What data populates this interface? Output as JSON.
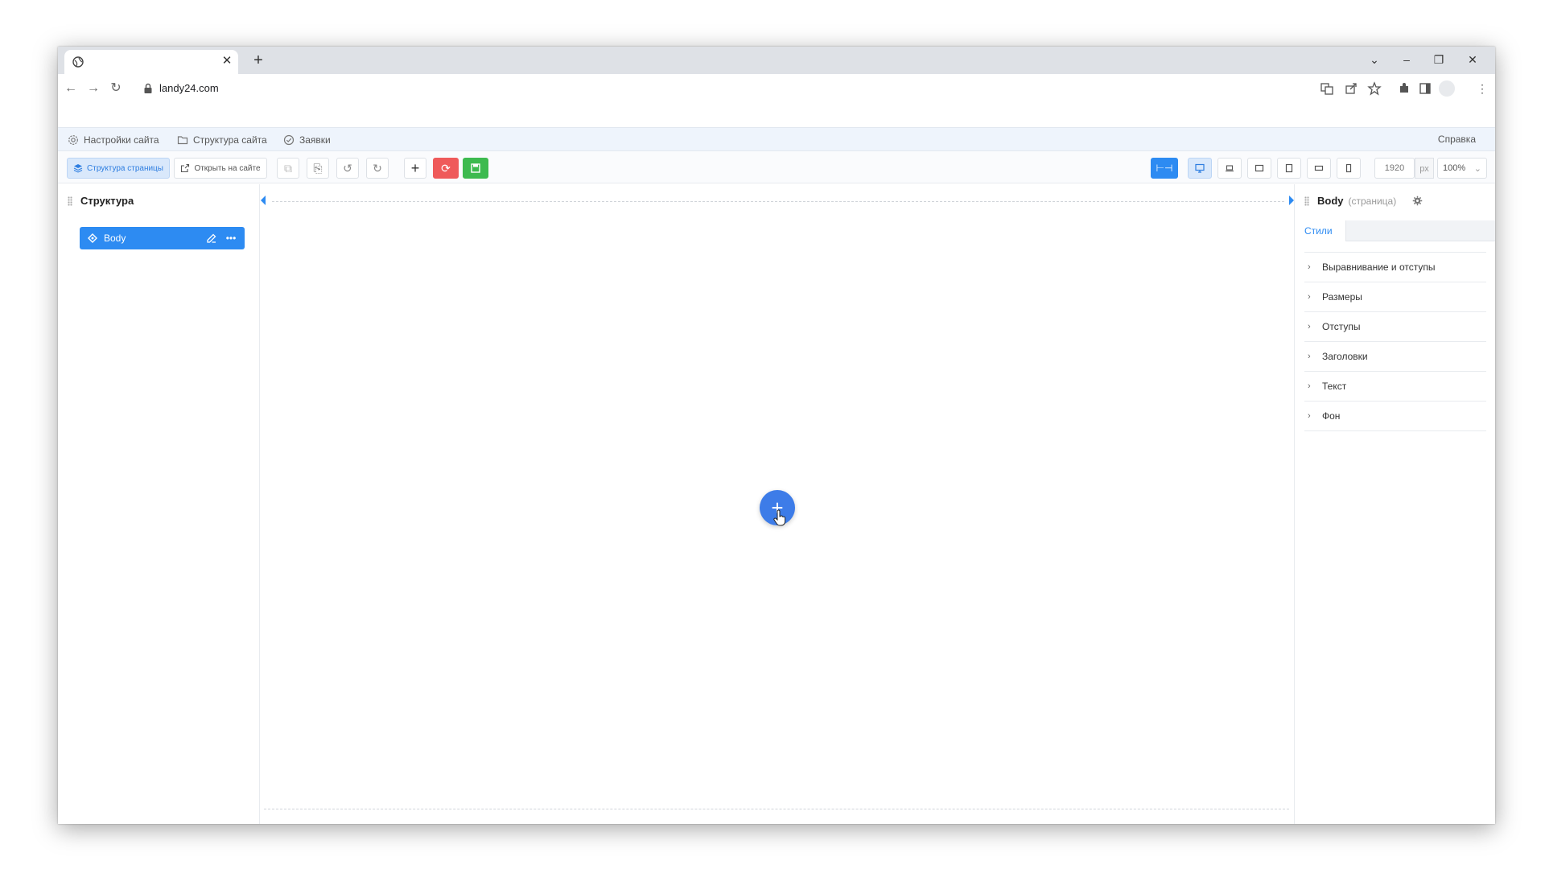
{
  "browser": {
    "tab_close": "✕",
    "new_tab": "+",
    "url": "landy24.com"
  },
  "app_menu": {
    "site_settings": "Настройки сайта",
    "site_structure": "Структура сайта",
    "requests": "Заявки",
    "help": "Справка"
  },
  "editor_toolbar": {
    "page_structure": "Структура страницы",
    "open_on_site": "Открыть на сайте",
    "width_value": "1920",
    "width_unit": "px",
    "zoom": "100%"
  },
  "structure_panel": {
    "title": "Структура",
    "items": [
      {
        "label": "Body"
      }
    ]
  },
  "properties_panel": {
    "element": "Body",
    "element_type": "(страница)",
    "tab": "Стили",
    "sections": [
      "Выравнивание и отступы",
      "Размеры",
      "Отступы",
      "Заголовки",
      "Текст",
      "Фон"
    ]
  },
  "canvas": {
    "add_label": "+"
  },
  "colors": {
    "accent": "#2d8bf2",
    "fab": "#3d7ce8",
    "reset": "#ef5a5a",
    "save": "#3dba4f"
  }
}
